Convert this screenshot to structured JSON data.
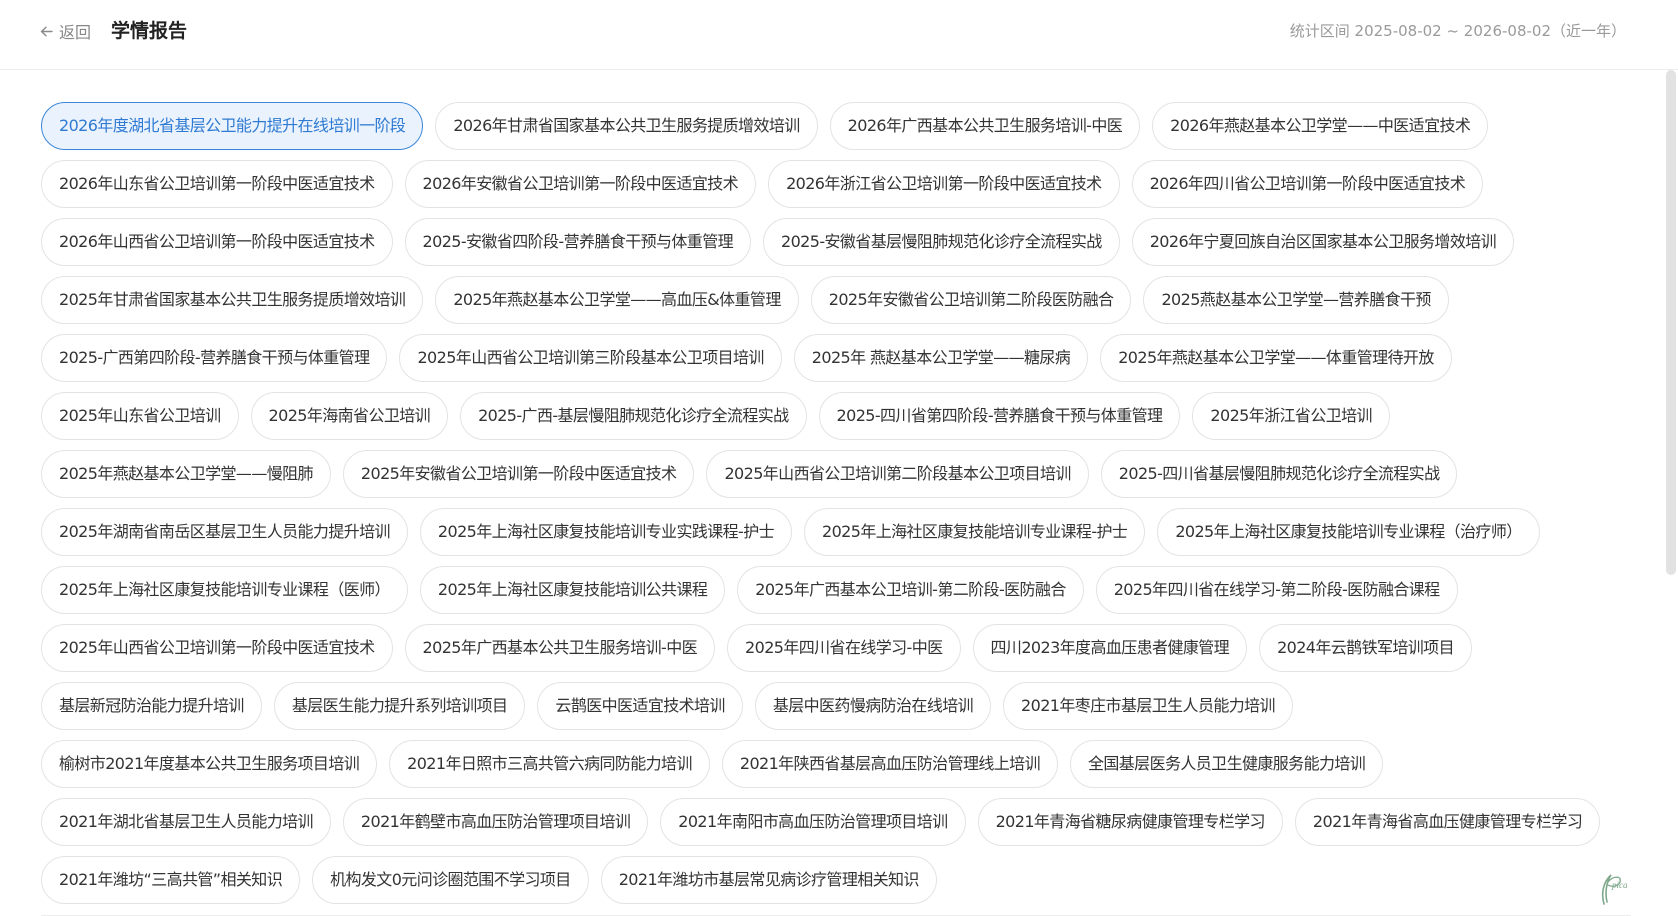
{
  "header": {
    "back_label": "返回",
    "title": "学情报告",
    "range_label": "统计区间 2025-08-02 ~ 2026-08-02（近一年）"
  },
  "programs": [
    {
      "label": "2026年度湖北省基层公卫能力提升在线培训一阶段",
      "selected": true
    },
    {
      "label": "2026年甘肃省国家基本公共卫生服务提质增效培训",
      "selected": false
    },
    {
      "label": "2026年广西基本公共卫生服务培训-中医",
      "selected": false
    },
    {
      "label": "2026年燕赵基本公卫学堂——中医适宜技术",
      "selected": false
    },
    {
      "label": "2026年山东省公卫培训第一阶段中医适宜技术",
      "selected": false
    },
    {
      "label": "2026年安徽省公卫培训第一阶段中医适宜技术",
      "selected": false
    },
    {
      "label": "2026年浙江省公卫培训第一阶段中医适宜技术",
      "selected": false
    },
    {
      "label": "2026年四川省公卫培训第一阶段中医适宜技术",
      "selected": false
    },
    {
      "label": "2026年山西省公卫培训第一阶段中医适宜技术",
      "selected": false
    },
    {
      "label": "2025-安徽省四阶段-营养膳食干预与体重管理",
      "selected": false
    },
    {
      "label": "2025-安徽省基层慢阻肺规范化诊疗全流程实战",
      "selected": false
    },
    {
      "label": "2026年宁夏回族自治区国家基本公卫服务增效培训",
      "selected": false
    },
    {
      "label": "2025年甘肃省国家基本公共卫生服务提质增效培训",
      "selected": false
    },
    {
      "label": "2025年燕赵基本公卫学堂——高血压&体重管理",
      "selected": false
    },
    {
      "label": "2025年安徽省公卫培训第二阶段医防融合",
      "selected": false
    },
    {
      "label": "2025燕赵基本公卫学堂—营养膳食干预",
      "selected": false
    },
    {
      "label": "2025-广西第四阶段-营养膳食干预与体重管理",
      "selected": false
    },
    {
      "label": "2025年山西省公卫培训第三阶段基本公卫项目培训",
      "selected": false
    },
    {
      "label": "2025年 燕赵基本公卫学堂——糖尿病",
      "selected": false
    },
    {
      "label": "2025年燕赵基本公卫学堂——体重管理待开放",
      "selected": false
    },
    {
      "label": "2025年山东省公卫培训",
      "selected": false
    },
    {
      "label": "2025年海南省公卫培训",
      "selected": false
    },
    {
      "label": "2025-广西-基层慢阻肺规范化诊疗全流程实战",
      "selected": false
    },
    {
      "label": "2025-四川省第四阶段-营养膳食干预与体重管理",
      "selected": false
    },
    {
      "label": "2025年浙江省公卫培训",
      "selected": false
    },
    {
      "label": "2025年燕赵基本公卫学堂——慢阻肺",
      "selected": false
    },
    {
      "label": "2025年安徽省公卫培训第一阶段中医适宜技术",
      "selected": false
    },
    {
      "label": "2025年山西省公卫培训第二阶段基本公卫项目培训",
      "selected": false
    },
    {
      "label": "2025-四川省基层慢阻肺规范化诊疗全流程实战",
      "selected": false
    },
    {
      "label": "2025年湖南省南岳区基层卫生人员能力提升培训",
      "selected": false
    },
    {
      "label": "2025年上海社区康复技能培训专业实践课程-护士",
      "selected": false
    },
    {
      "label": "2025年上海社区康复技能培训专业课程-护士",
      "selected": false
    },
    {
      "label": "2025年上海社区康复技能培训专业课程（治疗师）",
      "selected": false
    },
    {
      "label": "2025年上海社区康复技能培训专业课程（医师）",
      "selected": false
    },
    {
      "label": "2025年上海社区康复技能培训公共课程",
      "selected": false
    },
    {
      "label": "2025年广西基本公卫培训-第二阶段-医防融合",
      "selected": false
    },
    {
      "label": "2025年四川省在线学习-第二阶段-医防融合课程",
      "selected": false
    },
    {
      "label": "2025年山西省公卫培训第一阶段中医适宜技术",
      "selected": false
    },
    {
      "label": "2025年广西基本公共卫生服务培训-中医",
      "selected": false
    },
    {
      "label": "2025年四川省在线学习-中医",
      "selected": false
    },
    {
      "label": "四川2023年度高血压患者健康管理",
      "selected": false
    },
    {
      "label": "2024年云鹊铁军培训项目",
      "selected": false
    },
    {
      "label": "基层新冠防治能力提升培训",
      "selected": false
    },
    {
      "label": "基层医生能力提升系列培训项目",
      "selected": false
    },
    {
      "label": "云鹊医中医适宜技术培训",
      "selected": false
    },
    {
      "label": "基层中医药慢病防治在线培训",
      "selected": false
    },
    {
      "label": "2021年枣庄市基层卫生人员能力培训",
      "selected": false
    },
    {
      "label": "榆树市2021年度基本公共卫生服务项目培训",
      "selected": false
    },
    {
      "label": "2021年日照市三高共管六病同防能力培训",
      "selected": false
    },
    {
      "label": "2021年陕西省基层高血压防治管理线上培训",
      "selected": false
    },
    {
      "label": "全国基层医务人员卫生健康服务能力培训",
      "selected": false
    },
    {
      "label": "2021年湖北省基层卫生人员能力培训",
      "selected": false
    },
    {
      "label": "2021年鹤壁市高血压防治管理项目培训",
      "selected": false
    },
    {
      "label": "2021年南阳市高血压防治管理项目培训",
      "selected": false
    },
    {
      "label": "2021年青海省糖尿病健康管理专栏学习",
      "selected": false
    },
    {
      "label": "2021年青海省高血压健康管理专栏学习",
      "selected": false
    },
    {
      "label": "2021年潍坊“三高共管”相关知识",
      "selected": false
    },
    {
      "label": "机构发文0元问诊圈范围不学习项目",
      "selected": false
    },
    {
      "label": "2021年潍坊市基层常见病诊疗管理相关知识",
      "selected": false
    }
  ],
  "watermark_label": "pica",
  "colors": {
    "accent": "#2f7ad2",
    "accent_border": "#3c86d8",
    "accent_bg": "#eaf3fd",
    "chip_border": "#e3e3e3",
    "text": "#333333",
    "muted": "#9a9a9a"
  },
  "icons": {
    "back": "arrow-left-icon",
    "watermark": "pica-logo-icon"
  }
}
